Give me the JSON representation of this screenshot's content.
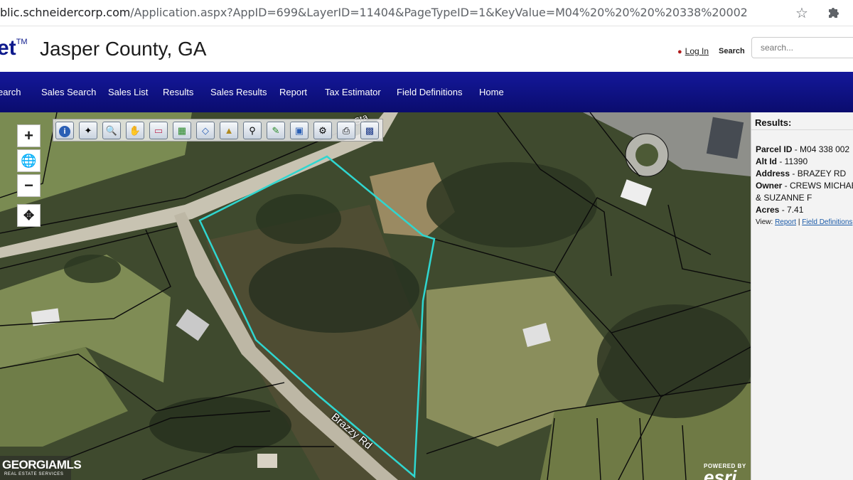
{
  "browser": {
    "url_main": "blic.schneidercorp.com",
    "url_rest": "/Application.aspx?AppID=699&LayerID=11404&PageTypeID=1&KeyValue=M04%20%20%20%20338%20002",
    "star_icon": "star-icon",
    "extensions_icon": "puzzle-icon"
  },
  "header": {
    "logo_fragment": "et",
    "logo_tm": "TM",
    "title": "Jasper County, GA",
    "login_label": "Log In",
    "search_label": "Search",
    "search_placeholder": "search..."
  },
  "nav": {
    "items": [
      "earch",
      "Sales Search",
      "Sales List",
      "Results",
      "Sales Results",
      "Report",
      "Tax Estimator",
      "Field Definitions",
      "Home"
    ]
  },
  "map": {
    "zoom_in": "+",
    "zoom_out": "−",
    "globe_icon": "globe-icon",
    "locate_icon": "crosshair-icon",
    "road_label_1": "Brazzy Rd",
    "road_label_2": "Sta",
    "parcel_outline_color": "#2fd6d0",
    "tools": [
      "info-icon",
      "select-icon",
      "zoom-in-tool-icon",
      "pan-hand-icon",
      "eraser-icon",
      "select-area-icon",
      "layers-icon",
      "buffer-icon",
      "find-icon",
      "draw-pencil-icon",
      "identify-icon",
      "measure-icon",
      "print-icon",
      "save-icon"
    ],
    "watermark_title": "GEORGIAMLS",
    "watermark_sub": "REAL ESTATE SERVICES",
    "esri_powered": "POWERED BY",
    "esri_logo": "esri"
  },
  "results": {
    "heading": "Results:",
    "parcel_id_label": "Parcel ID",
    "parcel_id": "M04 338 002",
    "alt_id_label": "Alt Id",
    "alt_id": "11390",
    "address_label": "Address",
    "address": "BRAZEY RD",
    "owner_label": "Owner",
    "owner_line1": "CREWS MICHAEL",
    "owner_line2": "& SUZANNE F",
    "acres_label": "Acres",
    "acres": "7.41",
    "view_label": "View:",
    "report_link": "Report",
    "field_defs_link": "Field Definitions"
  }
}
